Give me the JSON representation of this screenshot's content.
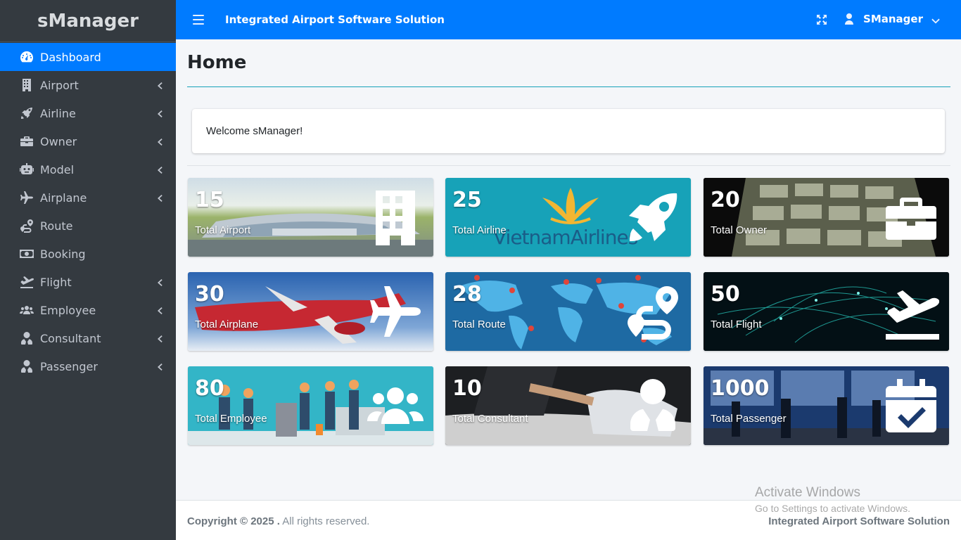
{
  "brand": "sManager",
  "sidebar": {
    "items": [
      {
        "label": "Dashboard",
        "icon": "tachometer-icon",
        "active": true,
        "has_submenu": false
      },
      {
        "label": "Airport",
        "icon": "building-icon",
        "active": false,
        "has_submenu": true
      },
      {
        "label": "Airline",
        "icon": "rocket-icon",
        "active": false,
        "has_submenu": true
      },
      {
        "label": "Owner",
        "icon": "briefcase-icon",
        "active": false,
        "has_submenu": true
      },
      {
        "label": "Model",
        "icon": "robot-icon",
        "active": false,
        "has_submenu": true
      },
      {
        "label": "Airplane",
        "icon": "plane-icon",
        "active": false,
        "has_submenu": true
      },
      {
        "label": "Route",
        "icon": "route-icon",
        "active": false,
        "has_submenu": false
      },
      {
        "label": "Booking",
        "icon": "money-bill-icon",
        "active": false,
        "has_submenu": false
      },
      {
        "label": "Flight",
        "icon": "plane-departure-icon",
        "active": false,
        "has_submenu": true
      },
      {
        "label": "Employee",
        "icon": "users-icon",
        "active": false,
        "has_submenu": true
      },
      {
        "label": "Consultant",
        "icon": "user-tie-icon",
        "active": false,
        "has_submenu": true
      },
      {
        "label": "Passenger",
        "icon": "user-tie-icon",
        "active": false,
        "has_submenu": true
      }
    ]
  },
  "topbar": {
    "title": "Integrated Airport Software Solution",
    "user": "SManager"
  },
  "page": {
    "title": "Home",
    "welcome": "Welcome sManager!"
  },
  "tiles": [
    {
      "value": "15",
      "label": "Total Airport",
      "icon": "building-icon"
    },
    {
      "value": "25",
      "label": "Total Airline",
      "icon": "rocket-icon",
      "logo_text": "VietnamAirlines"
    },
    {
      "value": "20",
      "label": "Total Owner",
      "icon": "briefcase-icon"
    },
    {
      "value": "30",
      "label": "Total Airplane",
      "icon": "plane-icon"
    },
    {
      "value": "28",
      "label": "Total Route",
      "icon": "route-icon"
    },
    {
      "value": "50",
      "label": "Total Flight",
      "icon": "plane-departure-icon"
    },
    {
      "value": "80",
      "label": "Total Employee",
      "icon": "users-icon"
    },
    {
      "value": "10",
      "label": "Total Consultant",
      "icon": "user-tie-icon"
    },
    {
      "value": "1000",
      "label": "Total Passenger",
      "icon": "calendar-check-icon"
    }
  ],
  "footer": {
    "copyright_bold": "Copyright © 2025 .",
    "copyright_rest": " All rights reserved.",
    "right": "Integrated Airport Software Solution"
  },
  "watermark": {
    "line1": "Activate Windows",
    "line2": "Go to Settings to activate Windows."
  },
  "colors": {
    "sidebar_bg": "#343a40",
    "primary": "#007bff",
    "content_bg": "#f4f6f9",
    "accent_rule": "#17a2b8"
  }
}
